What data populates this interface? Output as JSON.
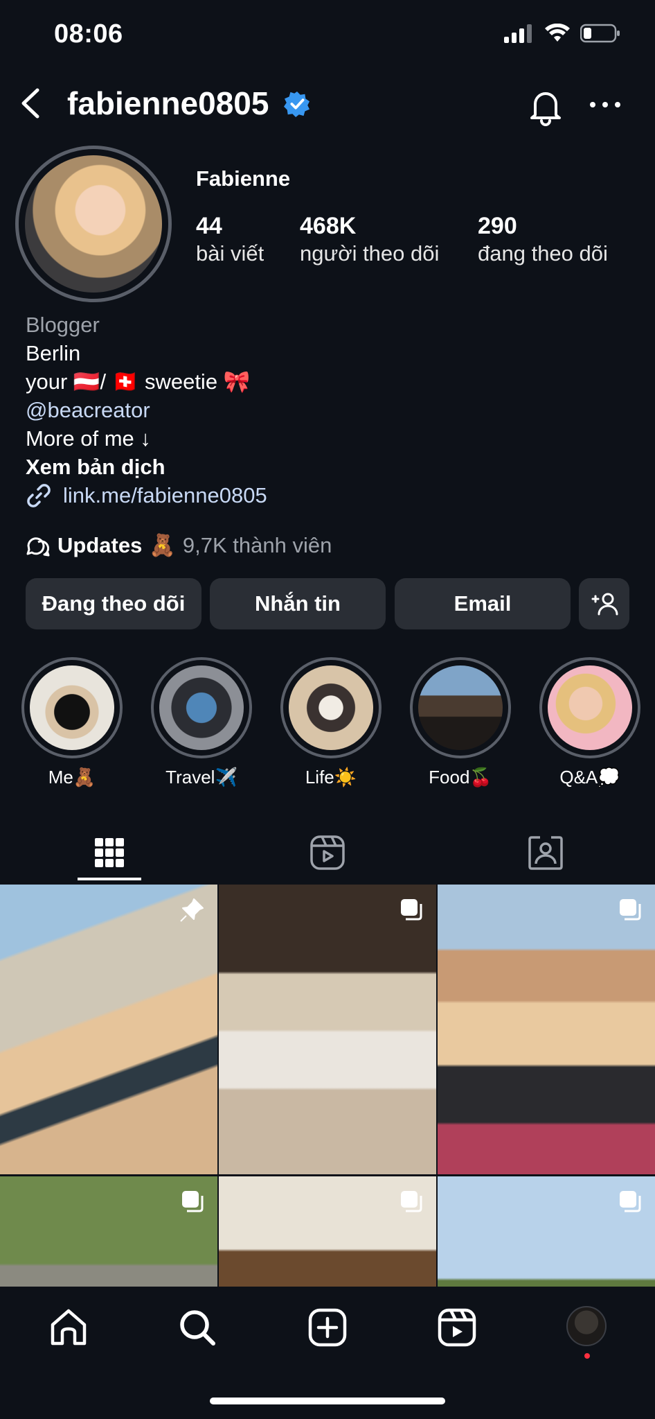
{
  "status_bar": {
    "time": "08:06"
  },
  "header": {
    "username": "fabienne0805"
  },
  "profile": {
    "display_name": "Fabienne",
    "stats": [
      {
        "value": "44",
        "label": "bài viết"
      },
      {
        "value": "468K",
        "label": "người theo dõi"
      },
      {
        "value": "290",
        "label": "đang theo dõi"
      }
    ]
  },
  "bio": {
    "category": "Blogger",
    "location": "Berlin",
    "line_sweetie": "your 🇦🇹/ 🇨🇭 sweetie 🎀",
    "mention": "@beacreator",
    "more": "More of me ↓",
    "translate": "Xem bản dịch",
    "url": "link.me/fabienne0805"
  },
  "channel": {
    "title": "Updates",
    "emoji": "🧸",
    "members": "9,7K thành viên"
  },
  "actions": {
    "following": "Đang theo dõi",
    "message": "Nhắn tin",
    "email": "Email"
  },
  "highlights": [
    {
      "label": "Me🧸"
    },
    {
      "label": "Travel✈️"
    },
    {
      "label": "Life☀️"
    },
    {
      "label": "Food🍒"
    },
    {
      "label": "Q&A💭"
    }
  ],
  "colors": {
    "background": "#0d1118",
    "button": "#2a2e35",
    "verified": "#3897f0",
    "link": "#c8d9f5",
    "notification_dot": "#ff3040"
  },
  "icons": {
    "tabs": [
      "grid-icon",
      "reels-icon",
      "tagged-icon"
    ],
    "nav": [
      "home-icon",
      "search-icon",
      "create-icon",
      "reels-icon",
      "profile-avatar"
    ]
  }
}
